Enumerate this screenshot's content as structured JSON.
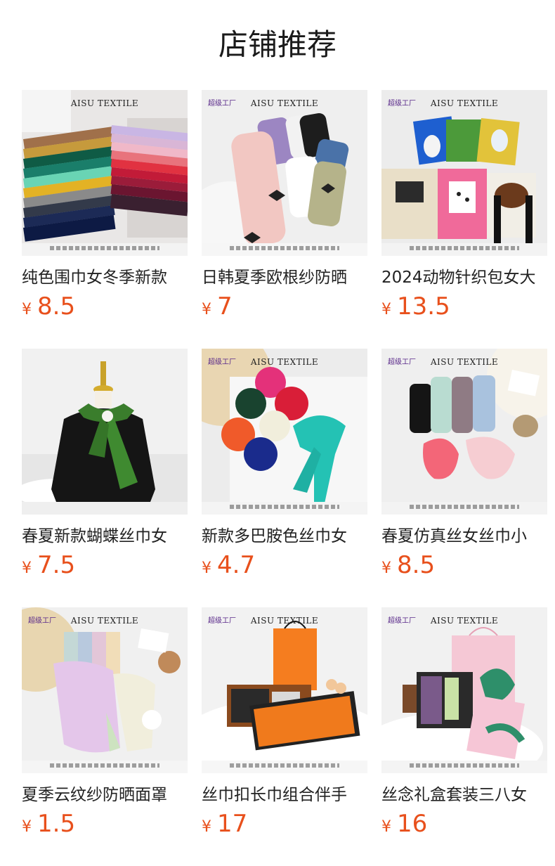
{
  "header": {
    "title": "店铺推荐"
  },
  "brand_text": "AISU TEXTILE",
  "badge_text": "超级工厂",
  "currency": "¥",
  "price_color": "#e8501c",
  "products": [
    {
      "name": "纯色围巾女冬季新款",
      "price": "8.5"
    },
    {
      "name": "日韩夏季欧根纱防晒",
      "price": "7"
    },
    {
      "name": "2024动物针织包女大",
      "price": "13.5"
    },
    {
      "name": "春夏新款蝴蝶丝巾女",
      "price": "7.5"
    },
    {
      "name": "新款多巴胺色丝巾女",
      "price": "4.7"
    },
    {
      "name": "春夏仿真丝女丝巾小",
      "price": "8.5"
    },
    {
      "name": "夏季云纹纱防晒面罩",
      "price": "1.5"
    },
    {
      "name": "丝巾扣长巾组合伴手",
      "price": "17"
    },
    {
      "name": "丝念礼盒套装三八女",
      "price": "16"
    }
  ]
}
